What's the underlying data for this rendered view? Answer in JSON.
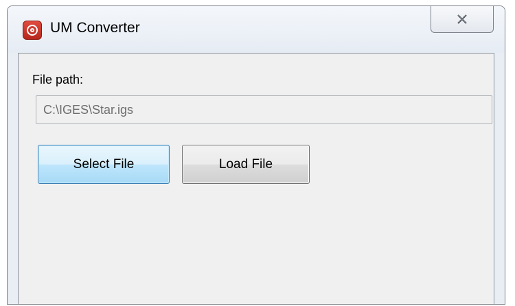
{
  "window": {
    "title": "UM Converter",
    "app_icon": "um-converter-app-icon",
    "close_icon": "close-icon"
  },
  "form": {
    "file_path_label": "File path:",
    "file_path_value": "C:\\IGES\\Star.igs"
  },
  "buttons": {
    "select_file_label": "Select File",
    "load_file_label": "Load File"
  },
  "colors": {
    "select_button_border": "#3c7fb1",
    "app_icon_red": "#c9322a"
  }
}
